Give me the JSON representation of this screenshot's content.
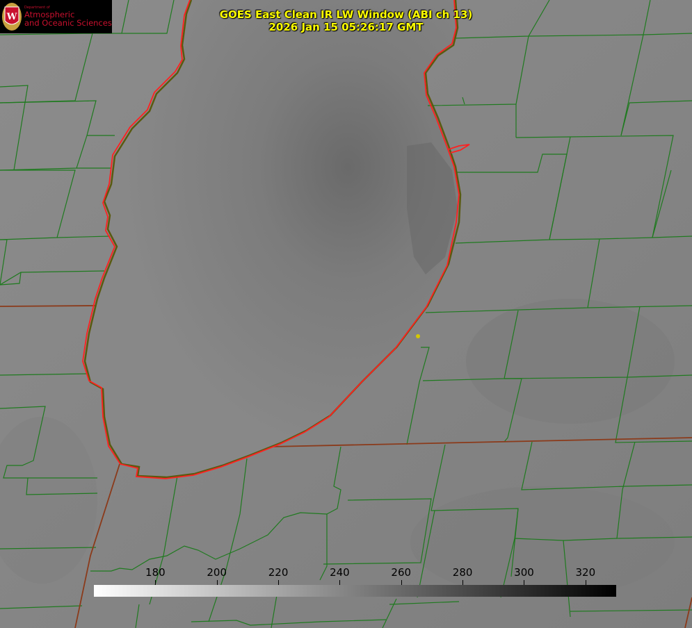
{
  "header": {
    "title": "GOES East Clean IR LW Window (ABI ch 13)",
    "timestamp": "2026 Jan 15 05:26:17 GMT"
  },
  "logo": {
    "dept_label": "Department of",
    "line1": "Atmospheric",
    "line2": "and Oceanic Sciences",
    "seal_letter": "W"
  },
  "colorbar": {
    "min": 160,
    "max": 330,
    "ticks": [
      180,
      200,
      220,
      240,
      260,
      280,
      300,
      320
    ],
    "palette": [
      "#ffffff",
      "#000000"
    ]
  },
  "colors": {
    "county_lines": "#1f7a1f",
    "state_lines": "#8b3a1a",
    "lake_outline": "#ff2020",
    "title_text": "#ffff00",
    "marker": "#d4c800"
  },
  "marker_icon": "station-dot-icon"
}
